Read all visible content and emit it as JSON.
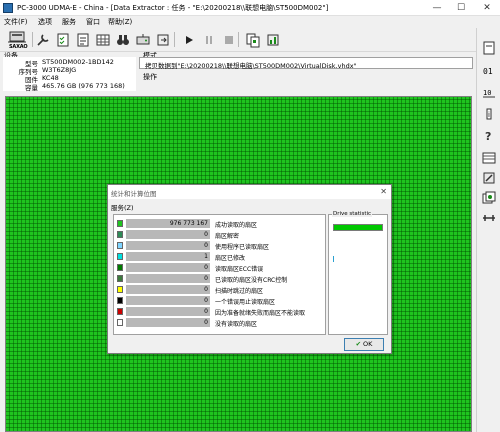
{
  "window": {
    "title": "PC-3000 UDMA-E - China - [Data Extractor : 任务 - \"E:\\20200218\\\\联想电脑\\ST500DM002\"]",
    "minimize": "—",
    "maximize": "☐",
    "close": "✕"
  },
  "menu": {
    "items": [
      "文件(F)",
      "选项",
      "服务",
      "窗口",
      "帮助(Z)"
    ]
  },
  "toolbar": {
    "saxao_label": "SAXAO"
  },
  "device": {
    "section_label": "设备",
    "rows": [
      {
        "label": "型号",
        "value": "ST500DM002-1BD142"
      },
      {
        "label": "序列号",
        "value": "W3T6Z8JG"
      },
      {
        "label": "固件",
        "value": "KC48"
      },
      {
        "label": "容量",
        "value": "465.76 GB (976 773 168)"
      }
    ]
  },
  "task": {
    "section_label": "模式",
    "text": "拷贝数据到\"E:\\20200218\\\\联想电脑\\ST500DM002\\VirtualDisk.vhdx\"",
    "ops_label": "操作"
  },
  "dialog": {
    "title": "统计和计算位图",
    "menu": "服务(Z)",
    "stats": [
      {
        "value": "976 773 167",
        "label": "成功读取的扇区",
        "color": "#1fc41f"
      },
      {
        "value": "0",
        "label": "扇区解密",
        "color": "#2e8b57"
      },
      {
        "value": "0",
        "label": "使用程序已读取扇区",
        "color": "#7fd4ff"
      },
      {
        "value": "1",
        "label": "扇区已修改",
        "color": "#00e0e0"
      },
      {
        "value": "0",
        "label": "读取扇区ECC错误",
        "color": "#007a00"
      },
      {
        "value": "0",
        "label": "已读取的扇区没有CRC控制",
        "color": "#3c7a3c"
      },
      {
        "value": "0",
        "label": "扫描时跳过的扇区",
        "color": "#ffff00"
      },
      {
        "value": "0",
        "label": "一个错误用止读取扇区",
        "color": "#000000"
      },
      {
        "value": "0",
        "label": "因为准备就绪失败而扇区不能读取",
        "color": "#cc0000"
      },
      {
        "value": "0",
        "label": "没有读取的扇区",
        "color": "#ffffff"
      }
    ],
    "drive_label": "Drive statistic",
    "ok_label": "OK"
  },
  "colors": {
    "read_ok": "#1fc41f",
    "accent": "#3c7fb1"
  }
}
